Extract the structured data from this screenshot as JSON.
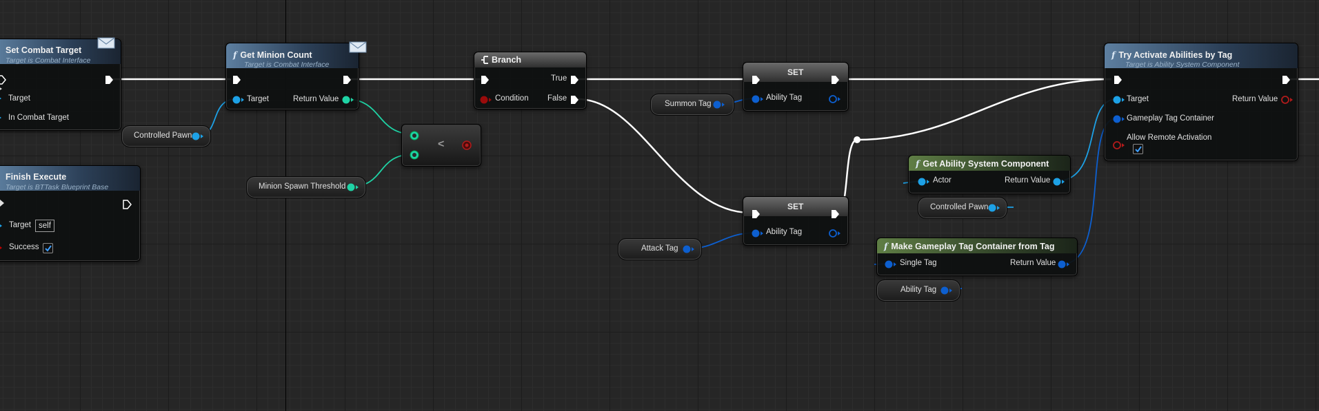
{
  "nodes": {
    "set_combat_target": {
      "title": "Set Combat Target",
      "subtitle": "Target is Combat Interface",
      "pins": [
        "Target",
        "In Combat Target"
      ]
    },
    "get_minion_count": {
      "title": "Get Minion Count",
      "subtitle": "Target is Combat Interface",
      "pin_target": "Target",
      "pin_return": "Return Value"
    },
    "finish_execute": {
      "title": "Finish Execute",
      "subtitle": "Target is BTTask Blueprint Base",
      "pin_target": "Target",
      "target_value": "self",
      "pin_success": "Success",
      "success_checked": true
    },
    "branch": {
      "title": "Branch",
      "pin_condition": "Condition",
      "pin_true": "True",
      "pin_false": "False"
    },
    "less_than": {
      "operator": "<"
    },
    "set_top": {
      "title": "SET",
      "pin": "Ability Tag"
    },
    "set_bottom": {
      "title": "SET",
      "pin": "Ability Tag"
    },
    "try_activate": {
      "title": "Try Activate Abilities by Tag",
      "subtitle": "Target is Ability System Component",
      "pin_target": "Target",
      "pin_container": "Gameplay Tag Container",
      "pin_remote": "Allow Remote Activation",
      "pin_return": "Return Value",
      "remote_checked": true
    },
    "get_asc": {
      "title": "Get Ability System Component",
      "pin_actor": "Actor",
      "pin_return": "Return Value"
    },
    "make_container": {
      "title": "Make Gameplay Tag Container from Tag",
      "pin_single": "Single Tag",
      "pin_return": "Return Value"
    }
  },
  "variables": {
    "controlled_pawn_1": "Controlled Pawn",
    "minion_spawn_threshold": "Minion Spawn Threshold",
    "summon_tag": "Summon Tag",
    "attack_tag": "Attack Tag",
    "controlled_pawn_2": "Controlled Pawn",
    "ability_tag": "Ability Tag"
  },
  "colors": {
    "exec_wire": "#ffffff",
    "object_pin": "#1da1e6",
    "struct_pin": "#0d5fcf",
    "int_pin": "#1fd3a5",
    "bool_pin": "#8c0000",
    "function_header": "#5d7fa0",
    "pure_header": "#5f7e45",
    "branch_header": "#6a6a6a"
  }
}
